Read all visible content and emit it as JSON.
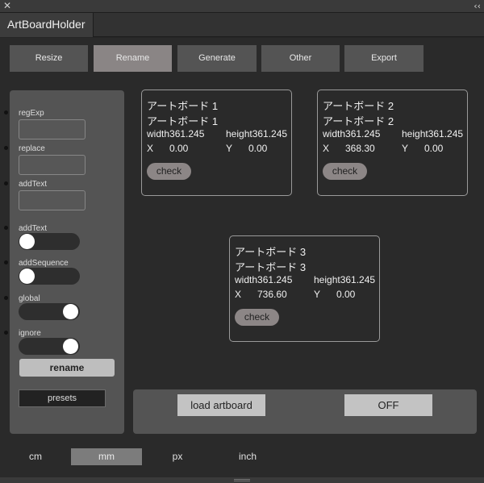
{
  "window": {
    "close_glyph": "✕",
    "collapse_glyph": "‹‹"
  },
  "panel_tab": {
    "title": "ArtBoardHolder"
  },
  "nav": [
    {
      "label": "Resize",
      "active": false
    },
    {
      "label": "Rename",
      "active": true
    },
    {
      "label": "Generate",
      "active": false
    },
    {
      "label": "Other",
      "active": false
    },
    {
      "label": "Export",
      "active": false
    }
  ],
  "sidebar": {
    "fields": [
      {
        "label": "regExp",
        "value": ""
      },
      {
        "label": "replace",
        "value": ""
      },
      {
        "label": "addText",
        "value": ""
      }
    ],
    "toggles": [
      {
        "label": "addText",
        "on": false
      },
      {
        "label": "addSequence",
        "on": false
      },
      {
        "label": "global",
        "on": true
      },
      {
        "label": "ignore",
        "on": true
      }
    ],
    "rename_label": "rename",
    "presets_label": "presets"
  },
  "artboards": [
    {
      "name": "アートボード 1",
      "new_name": "アートボード 1",
      "width": "width361.245",
      "height": "height361.245",
      "x_label": "X",
      "x": "0.00",
      "y_label": "Y",
      "y": "0.00",
      "check_label": "check"
    },
    {
      "name": "アートボード 2",
      "new_name": "アートボード 2",
      "width": "width361.245",
      "height": "height361.245",
      "x_label": "X",
      "x": "368.30",
      "y_label": "Y",
      "y": "0.00",
      "check_label": "check"
    },
    {
      "name": "アートボード 3",
      "new_name": "アートボード 3",
      "width": "width361.245",
      "height": "height361.245",
      "x_label": "X",
      "x": "736.60",
      "y_label": "Y",
      "y": "0.00",
      "check_label": "check"
    }
  ],
  "actions": {
    "load_label": "load artboard",
    "off_label": "OFF"
  },
  "units": [
    {
      "label": "cm",
      "active": false
    },
    {
      "label": "mm",
      "active": true
    },
    {
      "label": "px",
      "active": false
    },
    {
      "label": "inch",
      "active": false
    }
  ],
  "colors": {
    "background": "#2a2a2a",
    "panel": "#545454",
    "active_tab": "#8a8585",
    "button_light": "#c3c3c3"
  }
}
